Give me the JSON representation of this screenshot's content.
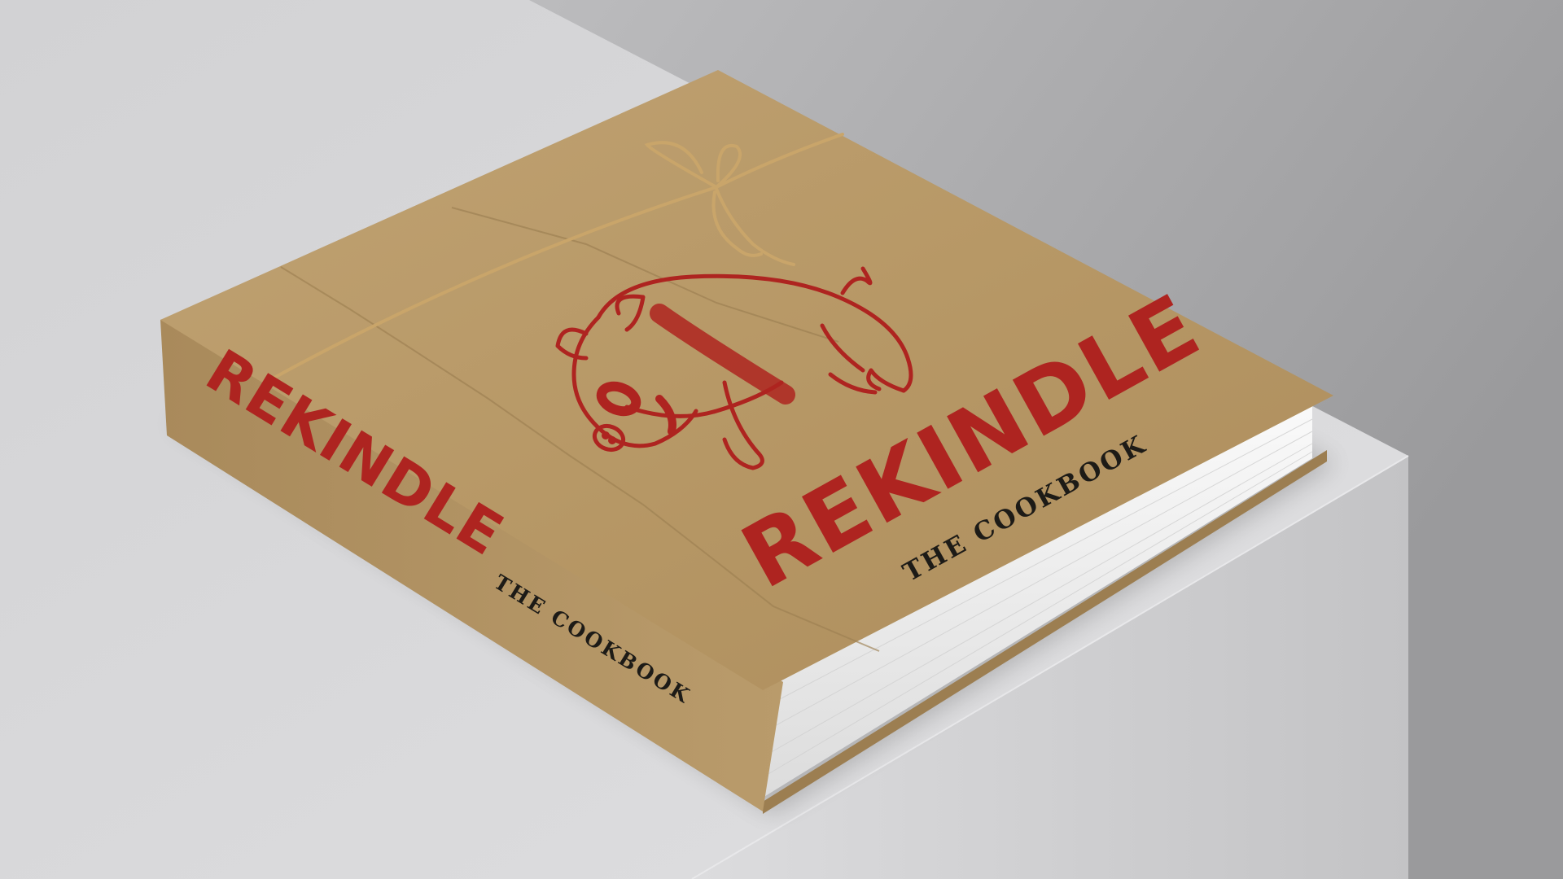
{
  "cover": {
    "title": "REKINDLE",
    "subtitle": "THE COOKBOOK"
  },
  "spine": {
    "title": "REKINDLE",
    "subtitle": "THE COOKBOOK"
  },
  "colors": {
    "kraft": "#b8996a",
    "stamp_red": "#ae2420",
    "ink": "#1d1b17",
    "plinth": "#d7d7d9",
    "backdrop": "#a7a7a9"
  },
  "icons": {
    "illustration": "pig-icon",
    "tie": "twine-bow-icon"
  }
}
